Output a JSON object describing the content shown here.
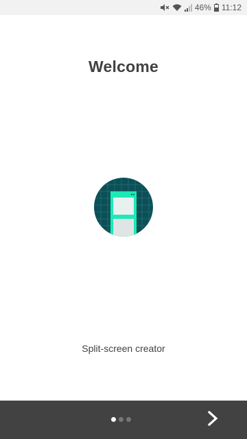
{
  "status_bar": {
    "icons": [
      "mute-icon",
      "wifi-icon",
      "signal-icon",
      "battery-icon"
    ],
    "battery_percent": "46%",
    "time": "11:12"
  },
  "onboarding": {
    "title": "Welcome",
    "subtitle": "Split-screen creator",
    "illustration_icon": "split-screen-icon"
  },
  "navigation": {
    "page_count": 3,
    "current_page": 1,
    "next_icon": "chevron-right-icon"
  },
  "colors": {
    "illustration_circle": "#0c4f56",
    "illustration_accent": "#1de9b6",
    "bottom_bar": "#424242",
    "title_text": "#424242"
  }
}
